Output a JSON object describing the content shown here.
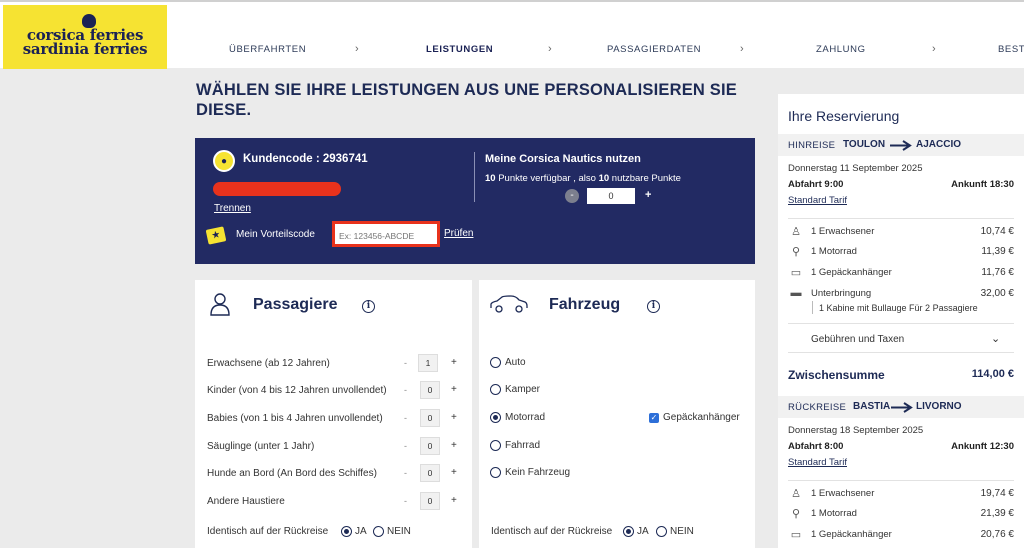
{
  "logo": {
    "line1": "corsica ferries",
    "line2": "sardinia ferries"
  },
  "steps": [
    "ÜBERFAHRTEN",
    "LEISTUNGEN",
    "PASSAGIERDATEN",
    "ZAHLUNG",
    "BESTÄ"
  ],
  "page_title": "WÄHLEN SIE IHRE LEISTUNGEN AUS UNE PERSONALISIEREN SIE DIESE.",
  "loyalty": {
    "customer_code": "Kundencode : 2936741",
    "disconnect": "Trennen",
    "voucher_label": "Mein Vorteilscode",
    "voucher_placeholder": "Ex: 123456-ABCDE",
    "check": "Prüfen",
    "nautics_title": "Meine Corsica Nautics nutzen",
    "points_a": "10",
    "points_text_a": " Punkte verfügbar , also ",
    "points_b": "10",
    "points_text_b": " nutzbare Punkte",
    "points_value": "0",
    "minus": "-",
    "plus": "+"
  },
  "passengers": {
    "title": "Passagiere",
    "rows": [
      {
        "label": "Erwachsene (ab 12 Jahren)",
        "value": "1"
      },
      {
        "label": "Kinder (von 4 bis 12 Jahren unvollendet)",
        "value": "0"
      },
      {
        "label": "Babies (von 1 bis 4 Jahren unvollendet)",
        "value": "0"
      },
      {
        "label": "Säuglinge (unter 1 Jahr)",
        "value": "0"
      },
      {
        "label": "Hunde an Bord (An Bord des Schiffes)",
        "value": "0"
      },
      {
        "label": "Andere Haustiere",
        "value": "0"
      }
    ],
    "same_return": "Identisch auf der Rückreise",
    "yes": "JA",
    "no": "NEIN"
  },
  "vehicle": {
    "title": "Fahrzeug",
    "options": [
      "Auto",
      "Kamper",
      "Motorrad",
      "Fahrrad",
      "Kein Fahrzeug"
    ],
    "selected": "Motorrad",
    "trailer": "Gepäckanhänger",
    "same_return": "Identisch auf der Rückreise",
    "yes": "JA",
    "no": "NEIN"
  },
  "reservation": {
    "title": "Ihre Reservierung",
    "outbound": {
      "label": "HINREISE",
      "from": "TOULON",
      "to": "AJACCIO",
      "date": "Donnerstag 11 September 2025",
      "depart": "Abfahrt 9:00",
      "arrive": "Ankunft 18:30",
      "tariff": "Standard Tarif",
      "items": [
        {
          "icon": "person-icon",
          "label": "1 Erwachsener",
          "price": "10,74 €"
        },
        {
          "icon": "motorbike-icon",
          "label": "1 Motorrad",
          "price": "11,39 €"
        },
        {
          "icon": "trailer-icon",
          "label": "1 Gepäckanhänger",
          "price": "11,76 €"
        },
        {
          "icon": "bed-icon",
          "label": "Unterbringung",
          "price": "32,00 €"
        }
      ],
      "cabin": "1 Kabine mit Bullauge Für 2 Passagiere",
      "fees": "Gebühren und Taxen",
      "subtotal_label": "Zwischensumme",
      "subtotal": "114,00 €"
    },
    "return": {
      "label": "RÜCKREISE",
      "from": "BASTIA",
      "to": "LIVORNO",
      "date": "Donnerstag 18 September 2025",
      "depart": "Abfahrt 8:00",
      "arrive": "Ankunft 12:30",
      "tariff": "Standard Tarif",
      "items": [
        {
          "icon": "person-icon",
          "label": "1 Erwachsener",
          "price": "19,74 €"
        },
        {
          "icon": "motorbike-icon",
          "label": "1 Motorrad",
          "price": "21,39 €"
        },
        {
          "icon": "trailer-icon",
          "label": "1 Gepäckanhänger",
          "price": "20,76 €"
        }
      ]
    }
  }
}
